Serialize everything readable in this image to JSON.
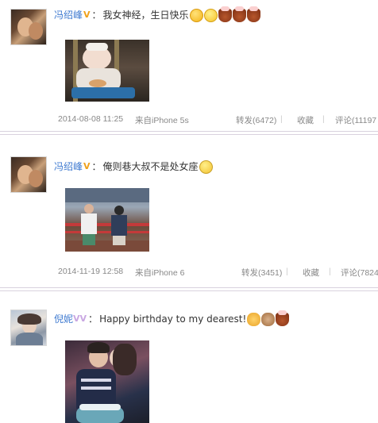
{
  "posts": [
    {
      "user": "冯绍峰",
      "badge": "V",
      "text": "我女神经，生日快乐",
      "emoticons": [
        "laugh-emoticon",
        "grin-emoticon",
        "cake-emoticon",
        "cake-emoticon",
        "cake-emoticon"
      ],
      "time": "2014-08-08 11:25",
      "source": "来自iPhone 5s",
      "repost": "转发(6472)",
      "favorite": "收藏",
      "comment": "评论(11197"
    },
    {
      "user": "冯绍峰",
      "badge": "V",
      "text": "俺则巷大叔不是处女座",
      "emoticons": [
        "sweat-emoticon"
      ],
      "time": "2014-11-19 12:58",
      "source": "来自iPhone 6",
      "repost": "转发(3451)",
      "favorite": "收藏",
      "comment": "评论(7824"
    },
    {
      "user": "倪妮",
      "badge": "VV",
      "text": "Happy birthday to my dearest!",
      "emoticons": [
        "cat-emoticon",
        "dog-emoticon",
        "cake-emoticon"
      ]
    }
  ],
  "separator": "|",
  "colors": {
    "username": "#3f7ad0",
    "badge": "#f0a11b",
    "meta_text": "#888888",
    "divider": "#d9d2de"
  }
}
